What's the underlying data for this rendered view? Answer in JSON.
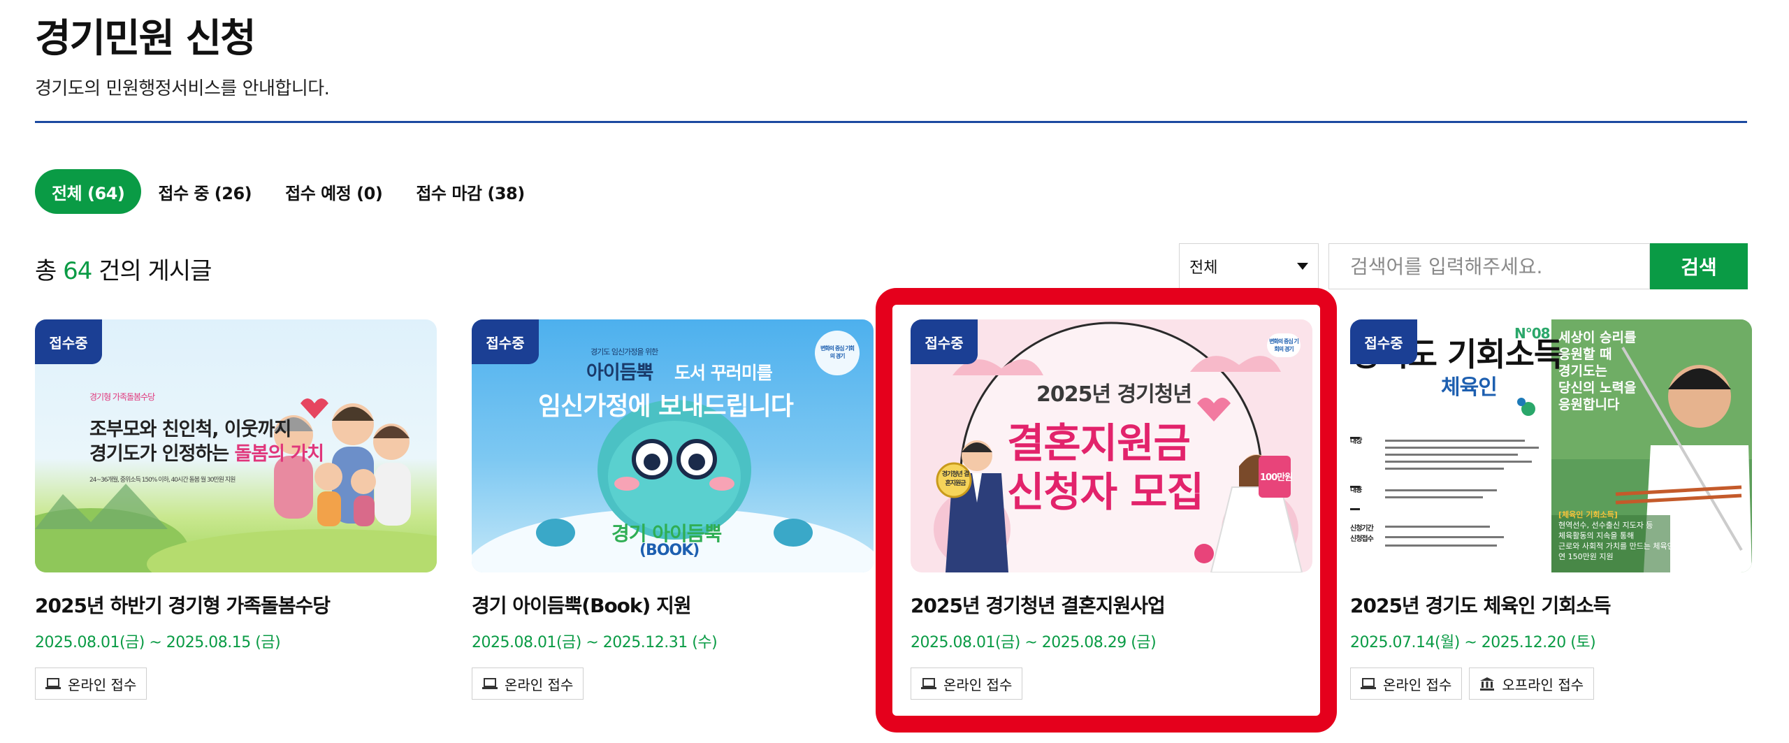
{
  "header": {
    "title": "경기민원 신청",
    "subtitle": "경기도의 민원행정서비스를 안내합니다."
  },
  "tabs": [
    {
      "label": "전체 (64)",
      "active": true
    },
    {
      "label": "접수 중 (26)",
      "active": false
    },
    {
      "label": "접수 예정 (0)",
      "active": false
    },
    {
      "label": "접수 마감 (38)",
      "active": false
    }
  ],
  "summary": {
    "prefix": "총",
    "count": "64",
    "suffix": "건의 게시글"
  },
  "search": {
    "select_value": "전체",
    "placeholder": "검색어를 입력해주세요.",
    "button_label": "검색"
  },
  "colors": {
    "accent": "#0a9b45",
    "badge": "#1b3f94",
    "divider": "#1c4aa0",
    "highlight": "#e5001c"
  },
  "cards": [
    {
      "badge": "접수중",
      "title": "2025년 하반기 경기형 가족돌봄수당",
      "date": "2025.08.01(금) ~ 2025.08.15 (금)",
      "chips": [
        {
          "label": "온라인 접수",
          "icon": "laptop-icon"
        }
      ],
      "thumb": {
        "kicker": "경기형 가족돌봄수당",
        "line1": "조부모와 친인척, 이웃까지",
        "line2a": "경기도가 인정하는 ",
        "line2b": "돌봄의 가치",
        "note": "24~36개월, 중위소득 150% 이하, 40시간 돌봄 월 30만원 지원"
      }
    },
    {
      "badge": "접수중",
      "title": "경기 아이듬뿍(Book) 지원",
      "date": "2025.08.01(금) ~ 2025.12.31 (수)",
      "chips": [
        {
          "label": "온라인 접수",
          "icon": "laptop-icon"
        }
      ],
      "thumb": {
        "top_small": "경기도 임신가정을 위한",
        "brand": "아이듬뿍",
        "tagline": "도서 꾸러미를",
        "headline": "임신가정에 보내드립니다",
        "bottom1": "경기 아이듬뿍",
        "bottom2": "(BOOK)",
        "logo": "변화의 중심 기회의 경기"
      }
    },
    {
      "badge": "접수중",
      "title": "2025년 경기청년 결혼지원사업",
      "date": "2025.08.01(금) ~ 2025.08.29 (금)",
      "chips": [
        {
          "label": "온라인 접수",
          "icon": "laptop-icon"
        }
      ],
      "thumb": {
        "year": "2025년 경기청년",
        "line1": "결혼지원금",
        "line2": "신청자 모집",
        "stamp": "경기청년 결혼지원금",
        "sign": "100만원",
        "logo": "변화의 중심 기회의 경기"
      }
    },
    {
      "badge": "접수중",
      "title": "2025년 경기도 체육인 기회소득",
      "date": "2025.07.14(월) ~ 2025.12.20 (토)",
      "chips": [
        {
          "label": "온라인 접수",
          "icon": "laptop-icon"
        },
        {
          "label": "오프라인 접수",
          "icon": "building-icon"
        }
      ],
      "thumb": {
        "no": "N°08",
        "head": "경기도 기회소득",
        "sub": "체육인",
        "quote": [
          "세상이 승리를",
          "응원할 때",
          "경기도는",
          "당신의 노력을",
          "응원합니다"
        ],
        "rows": [
          "대상",
          "내용",
          "신청기간",
          "신청접수"
        ],
        "bottom_label": "[체육인 기회소득]",
        "bottom_lines": [
          "현역선수, 선수출신 지도자 등",
          "체육활동의 지속을 통해",
          "근로와 사회적 가치를 만드는 체육인",
          "연 150만원 지원"
        ]
      }
    }
  ]
}
